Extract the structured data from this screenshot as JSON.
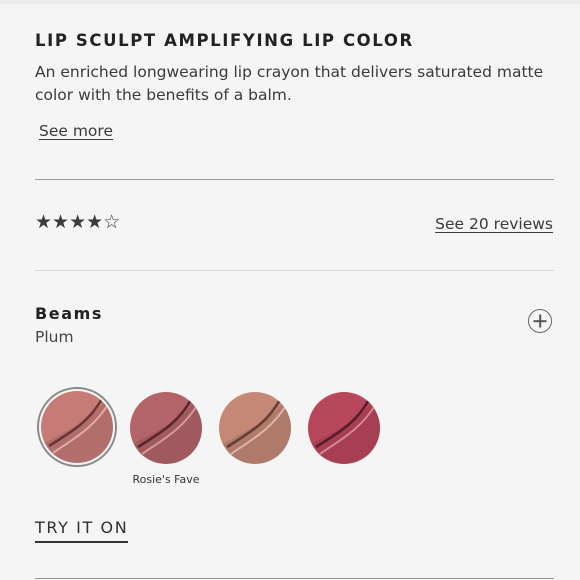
{
  "product": {
    "title": "LIP SCULPT AMPLIFYING LIP COLOR",
    "description": "An enriched longwearing lip crayon that delivers saturated matte color with the benefits of a balm.",
    "see_more_label": "See more"
  },
  "rating": {
    "value": 4,
    "max": 5,
    "stars_text": "★★★★☆",
    "reviews_label": "See 20 reviews"
  },
  "shade": {
    "name": "Beams",
    "family": "Plum"
  },
  "swatches": [
    {
      "color": "#c77b76",
      "selected": true,
      "label": ""
    },
    {
      "color": "#b36468",
      "selected": false,
      "label": "Rosie's Fave"
    },
    {
      "color": "#c58877",
      "selected": false,
      "label": ""
    },
    {
      "color": "#b9475c",
      "selected": false,
      "label": ""
    }
  ],
  "try_on_label": "TRY IT ON"
}
